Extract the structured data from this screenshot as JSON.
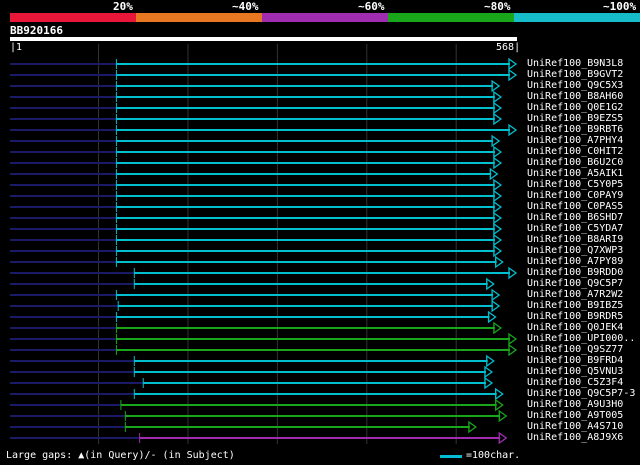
{
  "scale": {
    "colors": [
      "#e8173a",
      "#e87722",
      "#a02db0",
      "#1aa61a",
      "#16bcc8"
    ],
    "labels": [
      "20%",
      "~40%",
      "~60%",
      "~80%",
      "~100%"
    ]
  },
  "query": {
    "name": "BB920166",
    "start": "1",
    "end": "568",
    "length": 568
  },
  "hit_colors": {
    "cyan": "#00c0d0",
    "green": "#1aa61a",
    "purple": "#a02db0",
    "dark": "#1a1a66"
  },
  "hits": [
    {
      "label": "UniRef100_B9N3L8",
      "start": 1,
      "end": 568,
      "aligned_from": 120,
      "color": "cyan"
    },
    {
      "label": "UniRef100_B9GVT2",
      "start": 1,
      "end": 568,
      "aligned_from": 120,
      "color": "cyan"
    },
    {
      "label": "UniRef100_Q9C5X3",
      "start": 1,
      "end": 548,
      "aligned_from": 120,
      "color": "cyan"
    },
    {
      "label": "UniRef100_B8AH60",
      "start": 1,
      "end": 550,
      "aligned_from": 120,
      "color": "cyan"
    },
    {
      "label": "UniRef100_Q0E1G2",
      "start": 1,
      "end": 550,
      "aligned_from": 120,
      "color": "cyan"
    },
    {
      "label": "UniRef100_B9EZS5",
      "start": 1,
      "end": 550,
      "aligned_from": 120,
      "color": "cyan"
    },
    {
      "label": "UniRef100_B9RBT6",
      "start": 1,
      "end": 568,
      "aligned_from": 120,
      "color": "cyan"
    },
    {
      "label": "UniRef100_A7PHY4",
      "start": 1,
      "end": 548,
      "aligned_from": 120,
      "color": "cyan"
    },
    {
      "label": "UniRef100_C0HIT2",
      "start": 1,
      "end": 550,
      "aligned_from": 120,
      "color": "cyan"
    },
    {
      "label": "UniRef100_B6U2C0",
      "start": 1,
      "end": 550,
      "aligned_from": 120,
      "color": "cyan"
    },
    {
      "label": "UniRef100_A5AIK1",
      "start": 1,
      "end": 546,
      "aligned_from": 120,
      "color": "cyan"
    },
    {
      "label": "UniRef100_C5Y0P5",
      "start": 1,
      "end": 550,
      "aligned_from": 120,
      "color": "cyan"
    },
    {
      "label": "UniRef100_C0PAY9",
      "start": 1,
      "end": 550,
      "aligned_from": 120,
      "color": "cyan"
    },
    {
      "label": "UniRef100_C0PAS5",
      "start": 1,
      "end": 550,
      "aligned_from": 120,
      "color": "cyan"
    },
    {
      "label": "UniRef100_B6SHD7",
      "start": 1,
      "end": 550,
      "aligned_from": 120,
      "color": "cyan"
    },
    {
      "label": "UniRef100_C5YDA7",
      "start": 1,
      "end": 550,
      "aligned_from": 120,
      "color": "cyan"
    },
    {
      "label": "UniRef100_B8ARI9",
      "start": 1,
      "end": 550,
      "aligned_from": 120,
      "color": "cyan"
    },
    {
      "label": "UniRef100_Q7XWP3",
      "start": 1,
      "end": 550,
      "aligned_from": 120,
      "color": "cyan"
    },
    {
      "label": "UniRef100_A7PY89",
      "start": 1,
      "end": 552,
      "aligned_from": 120,
      "color": "cyan"
    },
    {
      "label": "UniRef100_B9RDD0",
      "start": 1,
      "end": 568,
      "aligned_from": 140,
      "color": "cyan"
    },
    {
      "label": "UniRef100_Q9C5P7",
      "start": 1,
      "end": 542,
      "aligned_from": 140,
      "color": "cyan"
    },
    {
      "label": "UniRef100_A7R2W2",
      "start": 1,
      "end": 548,
      "aligned_from": 120,
      "color": "cyan"
    },
    {
      "label": "UniRef100_B9IBZ5",
      "start": 1,
      "end": 548,
      "aligned_from": 122,
      "color": "cyan"
    },
    {
      "label": "UniRef100_B9RDR5",
      "start": 1,
      "end": 544,
      "aligned_from": 120,
      "color": "cyan"
    },
    {
      "label": "UniRef100_Q0JEK4",
      "start": 1,
      "end": 550,
      "aligned_from": 120,
      "color": "green"
    },
    {
      "label": "UniRef100_UPI000..",
      "start": 1,
      "end": 570,
      "aligned_from": 120,
      "color": "green"
    },
    {
      "label": "UniRef100_Q9SZ77",
      "start": 1,
      "end": 570,
      "aligned_from": 120,
      "color": "green"
    },
    {
      "label": "UniRef100_B9FRD4",
      "start": 1,
      "end": 542,
      "aligned_from": 140,
      "color": "cyan"
    },
    {
      "label": "UniRef100_Q5VNU3",
      "start": 1,
      "end": 540,
      "aligned_from": 140,
      "color": "cyan"
    },
    {
      "label": "UniRef100_C5Z3F4",
      "start": 1,
      "end": 540,
      "aligned_from": 150,
      "color": "cyan"
    },
    {
      "label": "UniRef100_Q9C5P7-3",
      "start": 1,
      "end": 552,
      "aligned_from": 140,
      "color": "cyan"
    },
    {
      "label": "UniRef100_A9U3H0",
      "start": 1,
      "end": 552,
      "aligned_from": 125,
      "color": "green"
    },
    {
      "label": "UniRef100_A9T005",
      "start": 1,
      "end": 556,
      "aligned_from": 130,
      "color": "green"
    },
    {
      "label": "UniRef100_A4S710",
      "start": 1,
      "end": 522,
      "aligned_from": 130,
      "color": "green"
    },
    {
      "label": "UniRef100_A8J9X6",
      "start": 1,
      "end": 556,
      "aligned_from": 146,
      "color": "purple"
    }
  ],
  "legend": {
    "gaps": "Large gaps: ▲(in Query)/- (in Subject)",
    "scale": "=100char."
  }
}
